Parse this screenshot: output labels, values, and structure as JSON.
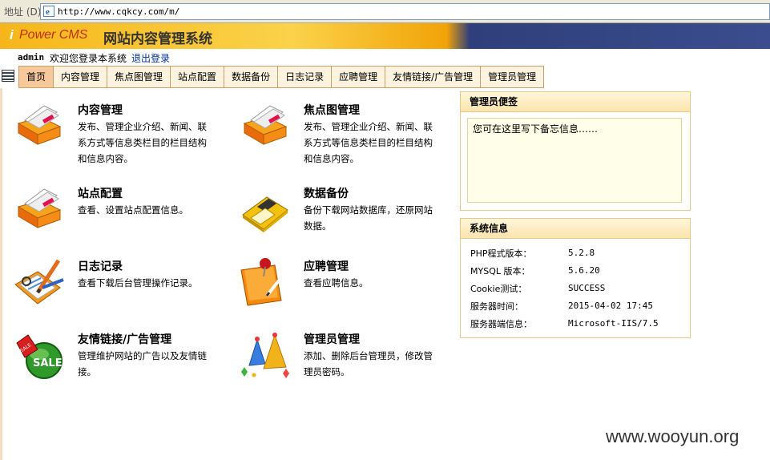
{
  "address": {
    "label": "地址 (D)",
    "url": "http://www.cqkcy.com/m/"
  },
  "header": {
    "brand_i": "i",
    "brand": "Power CMS",
    "title": "网站内容管理系统"
  },
  "welcome": {
    "user": "admin",
    "text": "欢迎您登录本系统",
    "logout": "退出登录"
  },
  "nav": {
    "tabs": [
      "首页",
      "内容管理",
      "焦点图管理",
      "站点配置",
      "数据备份",
      "日志记录",
      "应聘管理",
      "友情链接/广告管理",
      "管理员管理"
    ],
    "active": 0
  },
  "modules": [
    {
      "title": "内容管理",
      "desc": "发布、管理企业介绍、新闻、联系方式等信息类栏目的栏目结构和信息内容。",
      "icon": "content-stack-icon"
    },
    {
      "title": "焦点图管理",
      "desc": "发布、管理企业介绍、新闻、联系方式等信息类栏目的栏目结构和信息内容。",
      "icon": "focus-image-stack-icon"
    },
    {
      "title": "站点配置",
      "desc": "查看、设置站点配置信息。",
      "icon": "site-config-stack-icon"
    },
    {
      "title": "数据备份",
      "desc": "备份下载网站数据库，还原网站数据。",
      "icon": "floppy-disk-icon"
    },
    {
      "title": "日志记录",
      "desc": "查看下载后台管理操作记录。",
      "icon": "clipboard-pencil-icon"
    },
    {
      "title": "应聘管理",
      "desc": "查看应聘信息。",
      "icon": "notepad-pin-icon"
    },
    {
      "title": "友情链接/广告管理",
      "desc": "管理维护网站的广告以及友情链接。",
      "icon": "sale-tag-icon"
    },
    {
      "title": "管理员管理",
      "desc": "添加、删除后台管理员，修改管理员密码。",
      "icon": "party-hats-icon"
    }
  ],
  "memo": {
    "title": "管理员便签",
    "text": "您可在这里写下备忘信息……"
  },
  "sysinfo": {
    "title": "系统信息",
    "rows": [
      {
        "label": "PHP程式版本：",
        "value": "5.2.8"
      },
      {
        "label": "MYSQL 版本：",
        "value": "5.6.20"
      },
      {
        "label": "Cookie测试：",
        "value": "SUCCESS"
      },
      {
        "label": "服务器时间：",
        "value": "2015-04-02 17:45"
      },
      {
        "label": "服务器端信息：",
        "value": "Microsoft-IIS/7.5"
      }
    ]
  },
  "watermark": "www.wooyun.org",
  "colors": {
    "tab_bg": "#fdf3df",
    "tab_active": "#f6c89a",
    "banner_dark": "#2e3f7b",
    "memo_bg": "#ffffe9"
  }
}
